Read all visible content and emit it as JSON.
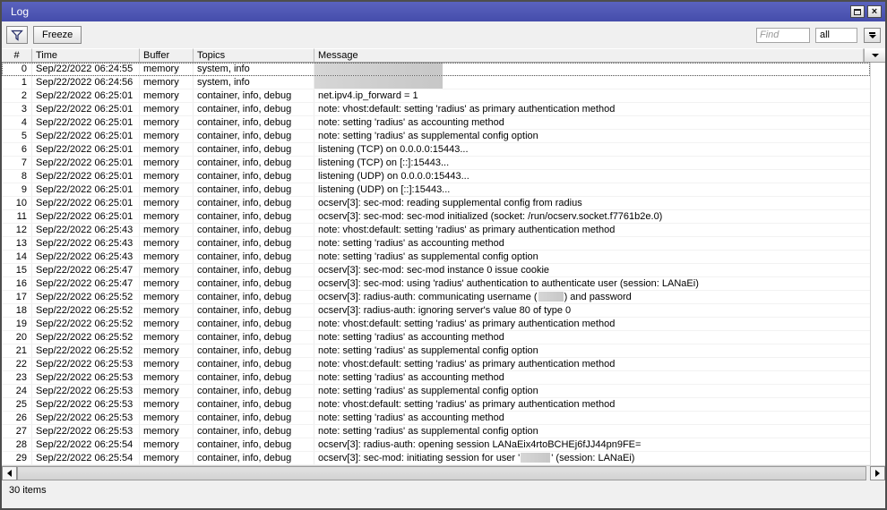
{
  "window": {
    "title": "Log"
  },
  "toolbar": {
    "freeze_label": "Freeze",
    "find_placeholder": "Find",
    "scope_value": "all"
  },
  "table": {
    "columns": [
      "#",
      "Time",
      "Buffer",
      "Topics",
      "Message"
    ],
    "rows": [
      {
        "n": "0",
        "time": "Sep/22/2022 06:24:55",
        "buffer": "memory",
        "topics": "system, info",
        "focused": true,
        "message": [
          {
            "redact": 143,
            "block": true
          }
        ]
      },
      {
        "n": "1",
        "time": "Sep/22/2022 06:24:56",
        "buffer": "memory",
        "topics": "system, info",
        "message": [
          {
            "redact": 143,
            "block": true
          }
        ]
      },
      {
        "n": "2",
        "time": "Sep/22/2022 06:25:01",
        "buffer": "memory",
        "topics": "container, info, debug",
        "message": "net.ipv4.ip_forward = 1"
      },
      {
        "n": "3",
        "time": "Sep/22/2022 06:25:01",
        "buffer": "memory",
        "topics": "container, info, debug",
        "message": "note: vhost:default: setting 'radius' as primary authentication method"
      },
      {
        "n": "4",
        "time": "Sep/22/2022 06:25:01",
        "buffer": "memory",
        "topics": "container, info, debug",
        "message": "note: setting 'radius' as accounting method"
      },
      {
        "n": "5",
        "time": "Sep/22/2022 06:25:01",
        "buffer": "memory",
        "topics": "container, info, debug",
        "message": "note: setting 'radius' as supplemental config option"
      },
      {
        "n": "6",
        "time": "Sep/22/2022 06:25:01",
        "buffer": "memory",
        "topics": "container, info, debug",
        "message": "listening (TCP) on 0.0.0.0:15443..."
      },
      {
        "n": "7",
        "time": "Sep/22/2022 06:25:01",
        "buffer": "memory",
        "topics": "container, info, debug",
        "message": "listening (TCP) on [::]:15443..."
      },
      {
        "n": "8",
        "time": "Sep/22/2022 06:25:01",
        "buffer": "memory",
        "topics": "container, info, debug",
        "message": "listening (UDP) on 0.0.0.0:15443..."
      },
      {
        "n": "9",
        "time": "Sep/22/2022 06:25:01",
        "buffer": "memory",
        "topics": "container, info, debug",
        "message": "listening (UDP) on [::]:15443..."
      },
      {
        "n": "10",
        "time": "Sep/22/2022 06:25:01",
        "buffer": "memory",
        "topics": "container, info, debug",
        "message": "ocserv[3]: sec-mod: reading supplemental config from radius"
      },
      {
        "n": "11",
        "time": "Sep/22/2022 06:25:01",
        "buffer": "memory",
        "topics": "container, info, debug",
        "message": "ocserv[3]: sec-mod: sec-mod initialized (socket: /run/ocserv.socket.f7761b2e.0)"
      },
      {
        "n": "12",
        "time": "Sep/22/2022 06:25:43",
        "buffer": "memory",
        "topics": "container, info, debug",
        "message": "note: vhost:default: setting 'radius' as primary authentication method"
      },
      {
        "n": "13",
        "time": "Sep/22/2022 06:25:43",
        "buffer": "memory",
        "topics": "container, info, debug",
        "message": "note: setting 'radius' as accounting method"
      },
      {
        "n": "14",
        "time": "Sep/22/2022 06:25:43",
        "buffer": "memory",
        "topics": "container, info, debug",
        "message": "note: setting 'radius' as supplemental config option"
      },
      {
        "n": "15",
        "time": "Sep/22/2022 06:25:47",
        "buffer": "memory",
        "topics": "container, info, debug",
        "message": "ocserv[3]: sec-mod: sec-mod instance 0 issue cookie"
      },
      {
        "n": "16",
        "time": "Sep/22/2022 06:25:47",
        "buffer": "memory",
        "topics": "container, info, debug",
        "message": "ocserv[3]: sec-mod: using 'radius' authentication to authenticate user (session: LANaEi)"
      },
      {
        "n": "17",
        "time": "Sep/22/2022 06:25:52",
        "buffer": "memory",
        "topics": "container, info, debug",
        "message": [
          {
            "text": "ocserv[3]: radius-auth: communicating username ("
          },
          {
            "redact": 28
          },
          {
            "text": ") and password"
          }
        ]
      },
      {
        "n": "18",
        "time": "Sep/22/2022 06:25:52",
        "buffer": "memory",
        "topics": "container, info, debug",
        "message": "ocserv[3]: radius-auth: ignoring server's value 80 of type 0"
      },
      {
        "n": "19",
        "time": "Sep/22/2022 06:25:52",
        "buffer": "memory",
        "topics": "container, info, debug",
        "message": "note: vhost:default: setting 'radius' as primary authentication method"
      },
      {
        "n": "20",
        "time": "Sep/22/2022 06:25:52",
        "buffer": "memory",
        "topics": "container, info, debug",
        "message": "note: setting 'radius' as accounting method"
      },
      {
        "n": "21",
        "time": "Sep/22/2022 06:25:52",
        "buffer": "memory",
        "topics": "container, info, debug",
        "message": "note: setting 'radius' as supplemental config option"
      },
      {
        "n": "22",
        "time": "Sep/22/2022 06:25:53",
        "buffer": "memory",
        "topics": "container, info, debug",
        "message": "note: vhost:default: setting 'radius' as primary authentication method"
      },
      {
        "n": "23",
        "time": "Sep/22/2022 06:25:53",
        "buffer": "memory",
        "topics": "container, info, debug",
        "message": "note: setting 'radius' as accounting method"
      },
      {
        "n": "24",
        "time": "Sep/22/2022 06:25:53",
        "buffer": "memory",
        "topics": "container, info, debug",
        "message": "note: setting 'radius' as supplemental config option"
      },
      {
        "n": "25",
        "time": "Sep/22/2022 06:25:53",
        "buffer": "memory",
        "topics": "container, info, debug",
        "message": "note: vhost:default: setting 'radius' as primary authentication method"
      },
      {
        "n": "26",
        "time": "Sep/22/2022 06:25:53",
        "buffer": "memory",
        "topics": "container, info, debug",
        "message": "note: setting 'radius' as accounting method"
      },
      {
        "n": "27",
        "time": "Sep/22/2022 06:25:53",
        "buffer": "memory",
        "topics": "container, info, debug",
        "message": "note: setting 'radius' as supplemental config option"
      },
      {
        "n": "28",
        "time": "Sep/22/2022 06:25:54",
        "buffer": "memory",
        "topics": "container, info, debug",
        "message": "ocserv[3]: radius-auth: opening session LANaEix4rtoBCHEj6fJJ44pn9FE="
      },
      {
        "n": "29",
        "time": "Sep/22/2022 06:25:54",
        "buffer": "memory",
        "topics": "container, info, debug",
        "message": [
          {
            "text": "ocserv[3]: sec-mod: initiating session for user '"
          },
          {
            "redact": 33
          },
          {
            "text": "' (session: LANaEi)"
          }
        ]
      }
    ]
  },
  "status": {
    "items_text": "30 items"
  },
  "colors": {
    "titlebar_blue": "#4d56b4",
    "redaction_gray": "#cccccc"
  }
}
